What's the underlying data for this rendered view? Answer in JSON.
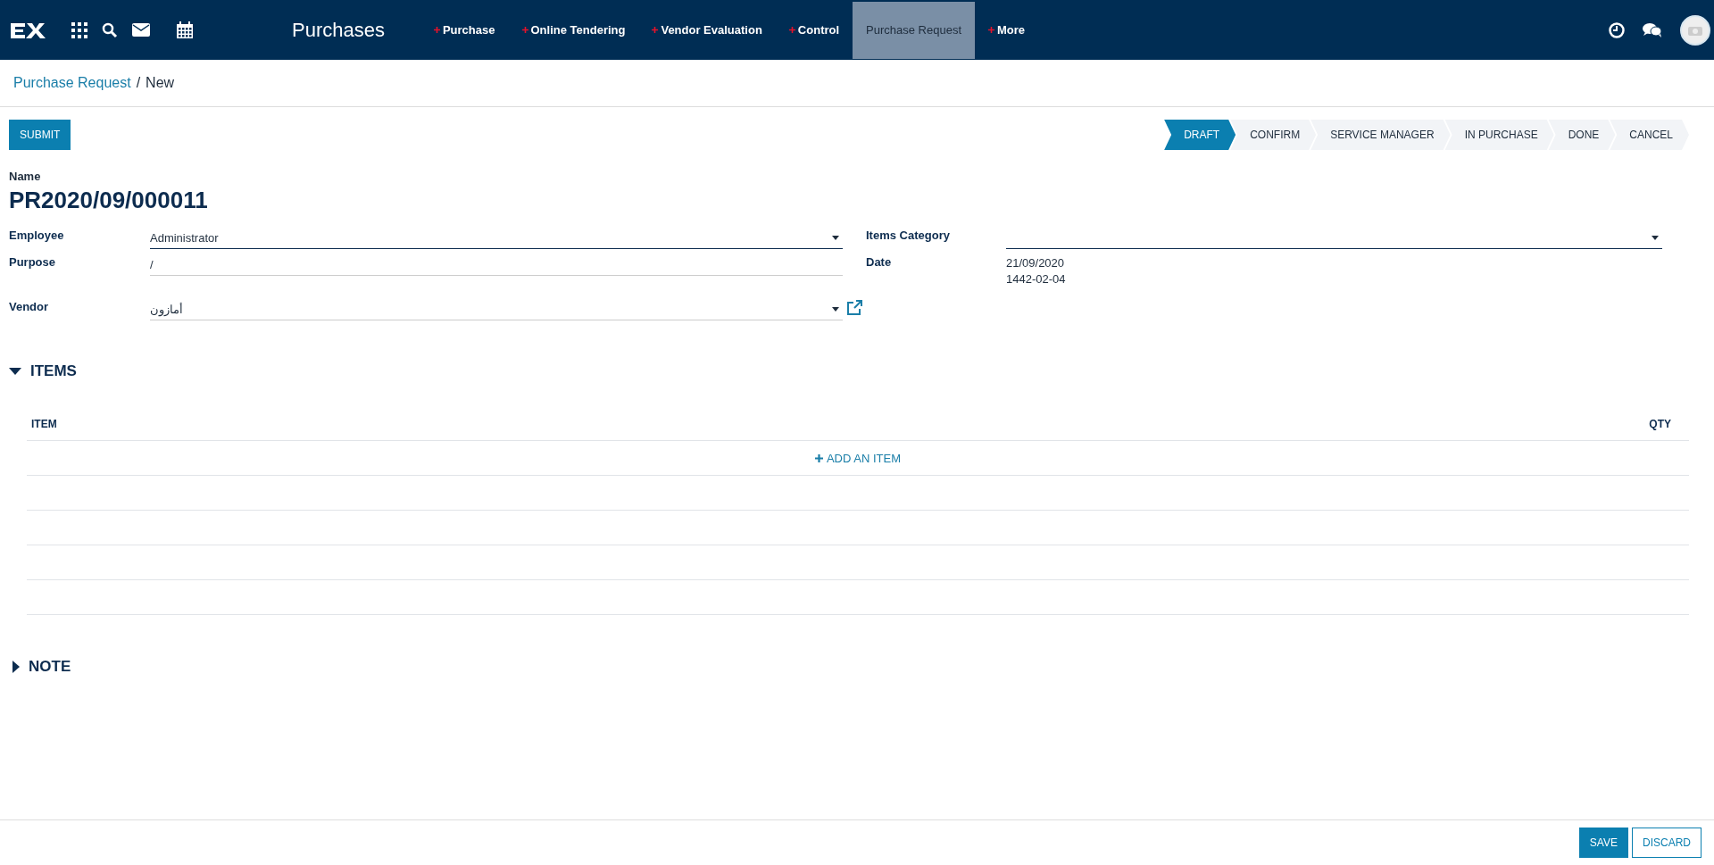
{
  "navbar": {
    "app_title": "Purchases",
    "menu": [
      {
        "label": "Purchase",
        "has_plus": true,
        "selected": false
      },
      {
        "label": "Online Tendering",
        "has_plus": true,
        "selected": false
      },
      {
        "label": "Vendor Evaluation",
        "has_plus": true,
        "selected": false
      },
      {
        "label": "Control",
        "has_plus": true,
        "selected": false
      },
      {
        "label": "Purchase Request",
        "has_plus": false,
        "selected": true
      },
      {
        "label": "More",
        "has_plus": true,
        "selected": false
      }
    ]
  },
  "breadcrumb_separator": "/",
  "breadcrumb": [
    {
      "label": "Purchase Request",
      "kind": "link"
    },
    {
      "label": "New",
      "kind": "current"
    }
  ],
  "actions": {
    "submit": "SUBMIT"
  },
  "status_bar": [
    {
      "label": "DRAFT",
      "selected": true
    },
    {
      "label": "CONFIRM",
      "selected": false
    },
    {
      "label": "SERVICE MANAGER",
      "selected": false
    },
    {
      "label": "IN PURCHASE",
      "selected": false
    },
    {
      "label": "DONE",
      "selected": false
    },
    {
      "label": "CANCEL",
      "selected": false
    }
  ],
  "form": {
    "name_label": "Name",
    "name": "PR2020/09/000011",
    "left_fields": [
      {
        "label": "Employee",
        "value": "Administrator",
        "kind": "select",
        "focused": true,
        "external_link": false
      },
      {
        "label": "Purpose",
        "value": "/",
        "kind": "text",
        "focused": false,
        "external_link": false
      },
      {
        "label": "Vendor",
        "value": "أمازون",
        "kind": "select",
        "focused": false,
        "external_link": true
      }
    ],
    "right_fields": [
      {
        "label": "Items Category",
        "kind": "select",
        "focused": true
      },
      {
        "label": "Date",
        "kind": "readonly",
        "lines": [
          "21/09/2020",
          "1442-02-04"
        ]
      }
    ]
  },
  "items_section": {
    "title": "ITEMS",
    "expanded": true,
    "columns": [
      "ITEM",
      "QTY"
    ],
    "add_item": "ADD AN ITEM"
  },
  "note_section": {
    "title": "NOTE",
    "expanded": false
  },
  "footer": {
    "buttons": [
      {
        "label": "SAVE",
        "kind": "primary"
      },
      {
        "label": "DISCARD",
        "kind": "secondary"
      }
    ]
  }
}
